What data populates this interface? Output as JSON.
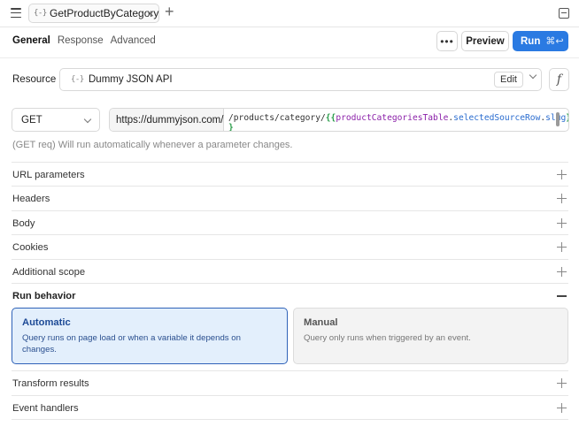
{
  "tab": {
    "name": "GetProductByCategory",
    "braces_icon": "{-}"
  },
  "subtabs": [
    "General",
    "Response",
    "Advanced"
  ],
  "actions": {
    "more": "•••",
    "preview": "Preview",
    "run": "Run",
    "run_shortcut": "⌘↩"
  },
  "resource": {
    "label": "Resource",
    "name": "Dummy JSON API",
    "edit": "Edit",
    "fx": "f"
  },
  "request": {
    "method": "GET",
    "base_url": "https://dummyjson.com/",
    "path_prefix": "/products/category/",
    "open_brace": "{{",
    "var": "productCategoriesTable",
    "prop1": "selectedSourceRow",
    "prop2": "slug",
    "close_brace": "}",
    "close_brace_wrap": "}"
  },
  "hint": "(GET req) Will run automatically whenever a parameter changes.",
  "sections": {
    "url_params": "URL parameters",
    "headers": "Headers",
    "body": "Body",
    "cookies": "Cookies",
    "additional_scope": "Additional scope",
    "run_behavior": "Run behavior",
    "transform": "Transform results",
    "events": "Event handlers"
  },
  "run_behavior": {
    "automatic_title": "Automatic",
    "automatic_desc": "Query runs on page load or when a variable it depends on changes.",
    "manual_title": "Manual",
    "manual_desc": "Query only runs when triggered by an event.",
    "selected": "Automatic"
  },
  "colors": {
    "accent": "#2a7ae2",
    "selected_border": "#2f62b8",
    "selected_bg": "#e3effc"
  }
}
